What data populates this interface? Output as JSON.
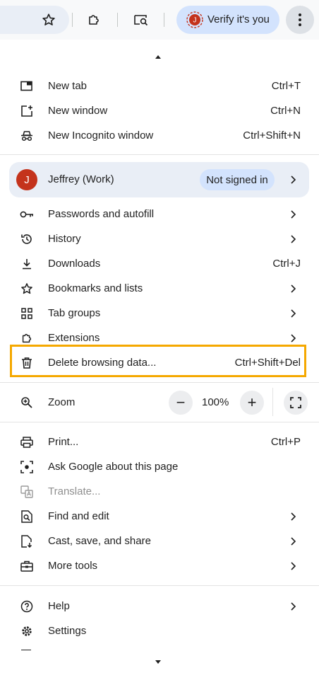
{
  "toolbar": {
    "verify_label": "Verify it's you",
    "verify_avatar_letter": "J",
    "icons": [
      "star-icon",
      "extensions-icon",
      "tab-search-icon",
      "more-vert-icon"
    ]
  },
  "menu": {
    "group1": [
      {
        "label": "New tab",
        "shortcut": "Ctrl+T",
        "icon": "new-tab-icon"
      },
      {
        "label": "New window",
        "shortcut": "Ctrl+N",
        "icon": "new-window-icon"
      },
      {
        "label": "New Incognito window",
        "shortcut": "Ctrl+Shift+N",
        "icon": "incognito-icon"
      }
    ],
    "profile": {
      "avatar_letter": "J",
      "name": "Jeffrey (Work)",
      "status": "Not signed in"
    },
    "group2": [
      {
        "label": "Passwords and autofill",
        "icon": "key-icon"
      },
      {
        "label": "History",
        "icon": "history-icon"
      },
      {
        "label": "Downloads",
        "shortcut": "Ctrl+J",
        "icon": "download-icon"
      },
      {
        "label": "Bookmarks and lists",
        "icon": "star-icon"
      },
      {
        "label": "Tab groups",
        "icon": "tab-groups-icon"
      },
      {
        "label": "Extensions",
        "icon": "extensions-icon"
      },
      {
        "label": "Delete browsing data...",
        "shortcut": "Ctrl+Shift+Del",
        "icon": "trash-icon"
      }
    ],
    "zoom": {
      "label": "Zoom",
      "minus": "−",
      "value": "100%",
      "plus": "+"
    },
    "group3": [
      {
        "label": "Print...",
        "shortcut": "Ctrl+P",
        "icon": "print-icon"
      },
      {
        "label": "Ask Google about this page",
        "icon": "lens-icon"
      },
      {
        "label": "Translate...",
        "icon": "translate-icon",
        "disabled": true
      },
      {
        "label": "Find and edit",
        "icon": "find-icon"
      },
      {
        "label": "Cast, save, and share",
        "icon": "cast-save-icon"
      },
      {
        "label": "More tools",
        "icon": "toolbox-icon"
      }
    ],
    "group4": [
      {
        "label": "Help",
        "icon": "help-icon"
      },
      {
        "label": "Settings",
        "icon": "settings-icon"
      }
    ]
  },
  "colors": {
    "highlight_border": "#f5a800",
    "avatar_bg": "#c4331c",
    "pill_bg": "#d3e3fd"
  }
}
